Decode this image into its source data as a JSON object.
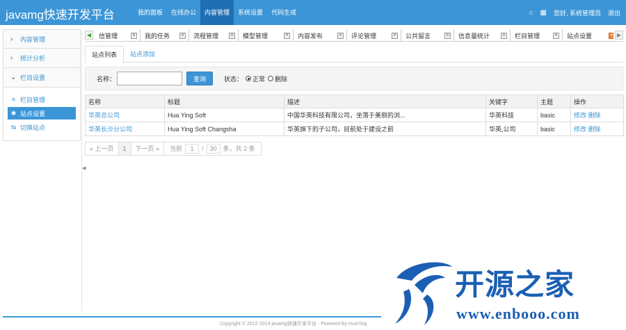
{
  "header": {
    "brand": "javamg快速开发平台",
    "nav": [
      {
        "label": "我的面板",
        "active": false
      },
      {
        "label": "在线办公",
        "active": false
      },
      {
        "label": "内容管理",
        "active": true
      },
      {
        "label": "系统设置",
        "active": false
      },
      {
        "label": "代码生成",
        "active": false
      }
    ],
    "greeting": "您好, 系统管理员",
    "logout": "退出"
  },
  "sidebar": {
    "menus": [
      {
        "label": "内容管理",
        "expanded": false
      },
      {
        "label": "统计分析",
        "expanded": false
      },
      {
        "label": "栏目设置",
        "expanded": true
      }
    ],
    "items": [
      {
        "label": "栏目管理",
        "icon": "list-icon",
        "active": false
      },
      {
        "label": "站点设置",
        "icon": "gear-icon",
        "active": true
      },
      {
        "label": "切换站点",
        "icon": "switch-icon",
        "active": false
      }
    ]
  },
  "tabstrip": {
    "tabs": [
      {
        "label": "信管理",
        "active": false
      },
      {
        "label": "我的任务",
        "active": false
      },
      {
        "label": "流程管理",
        "active": false
      },
      {
        "label": "模型管理",
        "active": false
      },
      {
        "label": "内容发布",
        "active": false
      },
      {
        "label": "评论管理",
        "active": false
      },
      {
        "label": "公共留言",
        "active": false
      },
      {
        "label": "信息量统计",
        "active": false
      },
      {
        "label": "栏目管理",
        "active": false
      },
      {
        "label": "站点设置",
        "active": true
      }
    ]
  },
  "subtabs": [
    {
      "label": "站点列表",
      "active": true
    },
    {
      "label": "站点添加",
      "active": false
    }
  ],
  "search": {
    "name_label": "名称：",
    "name_value": "",
    "query_button": "查询",
    "status_label": "状态：",
    "status_options": [
      {
        "label": "正常",
        "checked": true
      },
      {
        "label": "删除",
        "checked": false
      }
    ]
  },
  "table": {
    "columns": [
      "名称",
      "标题",
      "描述",
      "关键字",
      "主题",
      "操作"
    ],
    "rows": [
      {
        "name": "华英总公司",
        "title": "Hua Ying Soft",
        "desc": "中国华英科技有限公司，坐落于美丽的浏...",
        "keywords": "华英科技",
        "theme": "basic",
        "edit": "修改",
        "delete": "删除"
      },
      {
        "name": "华英长沙分公司",
        "title": "Hua Ying Soft Changsha",
        "desc": "华英旗下的子公司，目前处于建设之前",
        "keywords": "华英,公司",
        "theme": "basic",
        "edit": "修改",
        "delete": "删除"
      }
    ]
  },
  "pager": {
    "prev": "« 上一页",
    "current": "1",
    "next": "下一页 »",
    "current_label": "当前",
    "page_input": "1",
    "separator": "/",
    "page_size": "30",
    "summary": "条，共 2 条"
  },
  "footer": {
    "text": "Copyright © 2012-2014 javamg快速开发平台 - Powered By HuaYing"
  },
  "watermark": {
    "title": "开源之家",
    "url": "www.enbooo.com"
  },
  "colors": {
    "primary": "#3b95d6",
    "nav_active": "#1f6fb2",
    "watermark": "#1a5fb4"
  }
}
